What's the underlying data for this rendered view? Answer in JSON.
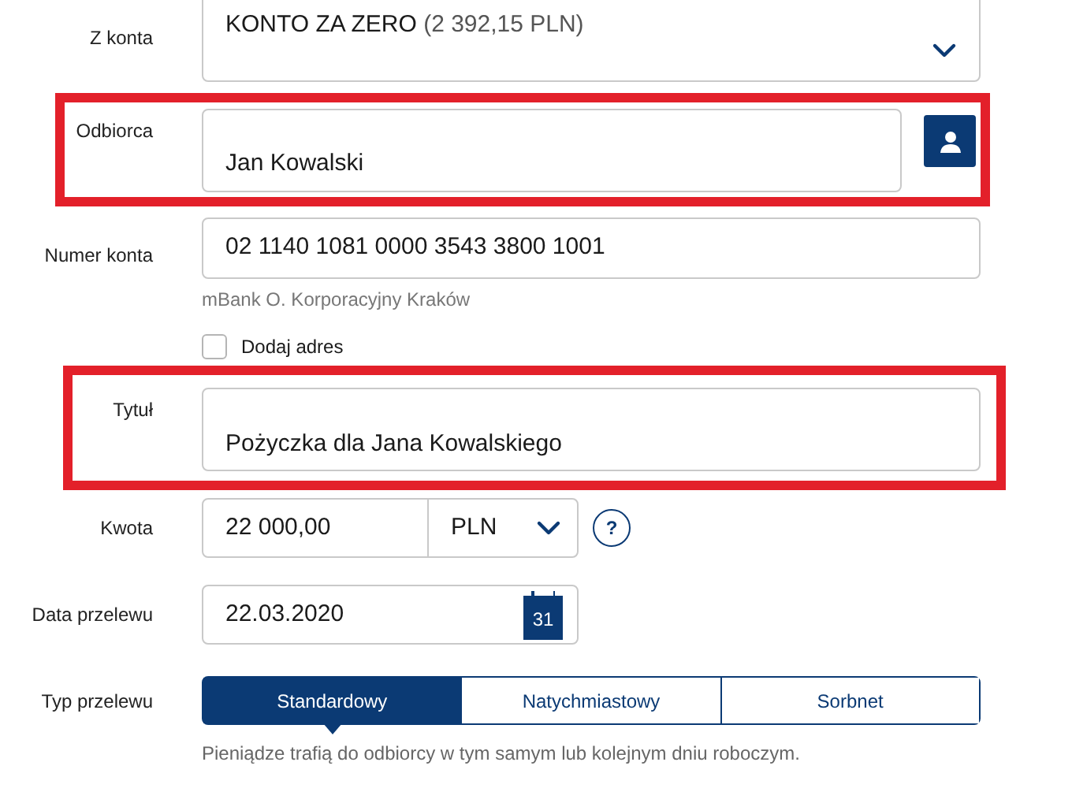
{
  "from_account": {
    "label": "Z konta",
    "name": "KONTO ZA ZERO",
    "balance": "(2 392,15 PLN)"
  },
  "recipient": {
    "label": "Odbiorca",
    "value": "Jan Kowalski",
    "highlighted": true
  },
  "account_number": {
    "label": "Numer konta",
    "value": "02 1140 1081 0000 3543 3800 1001",
    "bank": "mBank O. Korporacyjny Kraków"
  },
  "add_address": {
    "label": "Dodaj adres",
    "checked": false
  },
  "title": {
    "label": "Tytuł",
    "value": "Pożyczka dla Jana Kowalskiego",
    "highlighted": true
  },
  "amount": {
    "label": "Kwota",
    "value": "22 000,00",
    "currency": "PLN",
    "help": "?"
  },
  "date": {
    "label": "Data przelewu",
    "value": "22.03.2020",
    "calendar_day": "31"
  },
  "transfer_type": {
    "label": "Typ przelewu",
    "options": [
      {
        "label": "Standardowy",
        "selected": true
      },
      {
        "label": "Natychmiastowy",
        "selected": false
      },
      {
        "label": "Sorbnet",
        "selected": false
      }
    ],
    "note": "Pieniądze trafią do odbiorcy w tym samym lub kolejnym dniu roboczym."
  }
}
